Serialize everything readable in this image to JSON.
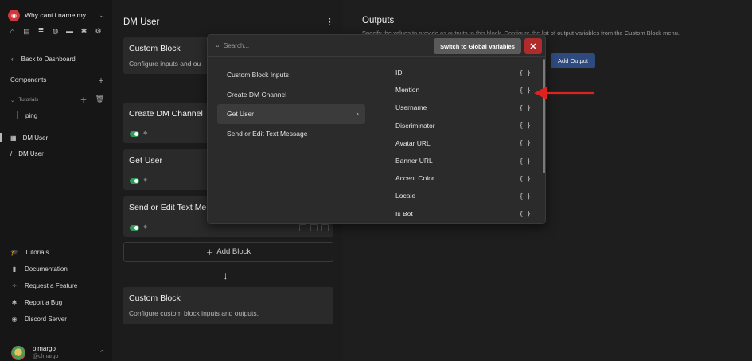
{
  "sidebar": {
    "server_name": "Why cant i name my...",
    "back_label": "Back to Dashboard",
    "components_label": "Components",
    "folder_label": "Tutorials",
    "ping_label": "ping",
    "dm_items": [
      "DM User",
      "DM User"
    ],
    "bottom_nav": [
      {
        "label": "Tutorials",
        "icon": "graduation-cap-icon"
      },
      {
        "label": "Documentation",
        "icon": "book-icon"
      },
      {
        "label": "Request a Feature",
        "icon": "wand-icon"
      },
      {
        "label": "Report a Bug",
        "icon": "bug-icon"
      },
      {
        "label": "Discord Server",
        "icon": "discord-icon"
      }
    ],
    "user": {
      "name": "olmargo",
      "handle": "@olmargo"
    }
  },
  "middle": {
    "title": "DM User",
    "custom_block_top": {
      "title": "Custom Block",
      "desc": "Configure inputs and ou"
    },
    "blocks": [
      {
        "title": "Create DM Channel"
      },
      {
        "title": "Get User"
      },
      {
        "title": "Send or Edit Text Me"
      }
    ],
    "add_block_label": "Add Block",
    "custom_block_bottom": {
      "title": "Custom Block",
      "desc": "Configure custom block inputs and outputs."
    }
  },
  "outputs": {
    "title": "Outputs",
    "desc": "Specify the values to provide as outputs to this block. Configure the list of output variables from the Custom Block menu.",
    "add_output_label": "Add Output"
  },
  "popup": {
    "search_placeholder": "Search...",
    "switch_label": "Switch to Global Variables",
    "close_label": "✕",
    "menu_items": [
      "Custom Block Inputs",
      "Create DM Channel",
      "Get User",
      "Send or Edit Text Message"
    ],
    "active_menu_index": 2,
    "variables": [
      "ID",
      "Mention",
      "Username",
      "Discriminator",
      "Avatar URL",
      "Banner URL",
      "Accent Color",
      "Locale",
      "Is Bot"
    ],
    "brace_glyph": "{ }"
  },
  "colors": {
    "accent_blue": "#2e4a7e",
    "close_red": "#b02b2b",
    "toggle_green": "#2f9a5a",
    "annotation_red": "#e0221e"
  }
}
